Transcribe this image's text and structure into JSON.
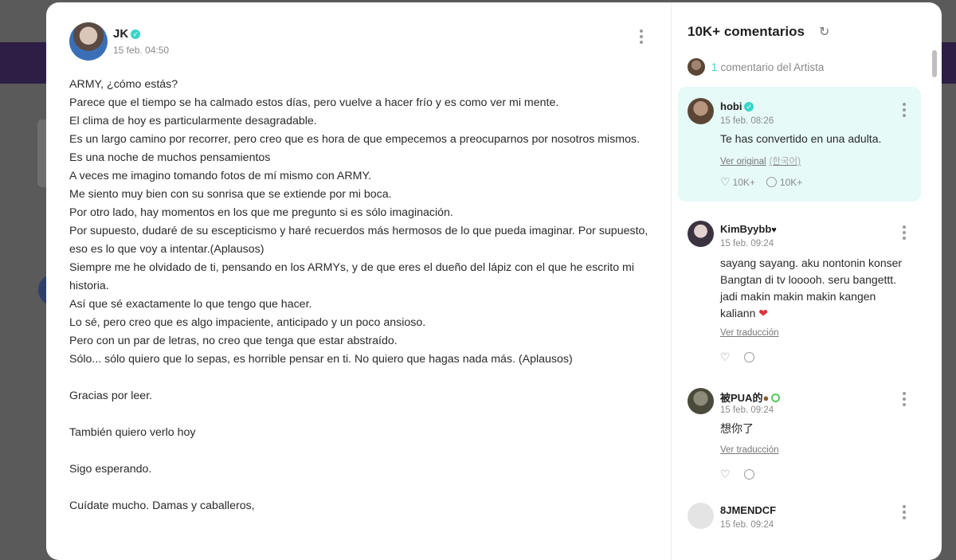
{
  "post": {
    "author": "JK",
    "date": "15 feb. 04:50",
    "paragraphs": [
      "ARMY, ¿cómo estás?",
      "Parece que el tiempo se ha calmado estos días, pero vuelve a hacer frío y es como ver mi mente.",
      "El clima de hoy es particularmente desagradable.",
      "Es un largo camino por recorrer, pero creo que es hora de que empecemos a preocuparnos por nosotros mismos.",
      "Es una noche de muchos pensamientos",
      "A veces me imagino tomando fotos de mí mismo con ARMY.",
      "Me siento muy bien con su sonrisa que se extiende por mi boca.",
      "Por otro lado, hay momentos en los que me pregunto si es sólo imaginación.",
      "Por supuesto, dudaré de su escepticismo y haré recuerdos más hermosos de lo que pueda imaginar. Por supuesto, eso es lo que voy a intentar.(Aplausos)",
      "Siempre me he olvidado de ti, pensando en los ARMYs, y de que eres el dueño del lápiz con el que he escrito mi historia.",
      "Así que sé exactamente lo que tengo que hacer.",
      "Lo sé, pero creo que es algo impaciente, anticipado y un poco ansioso.",
      "Pero con un par de letras, no creo que tenga que estar abstraído.",
      "Sólo... sólo quiero que lo sepas, es horrible pensar en ti. No quiero que hagas nada más. (Aplausos)"
    ],
    "closing": [
      "Gracias por leer.",
      "También quiero verlo hoy",
      "Sigo esperando.",
      "Cuídate mucho. Damas y caballeros,"
    ]
  },
  "comments_panel": {
    "title": "10K+ comentarios",
    "artist_count": "1",
    "artist_label": "comentario del Artista",
    "comments": [
      {
        "name": "hobi",
        "date": "15 feb. 08:26",
        "text": "Te has convertido en una adulta.",
        "link": "Ver original",
        "link_sub": "(한국어)",
        "likes": "10K+",
        "replies": "10K+"
      },
      {
        "name": "KimByybb",
        "date": "15 feb. 09:24",
        "text": "sayang sayang. aku nontonin konser Bangtan di tv looooh. seru bangettt. jadi makin makin makin kangen kaliann",
        "link": "Ver traducción"
      },
      {
        "name": "被PUA的",
        "date": "15 feb. 09:24",
        "text": "想你了",
        "link": "Ver traducción"
      },
      {
        "name": "8JMENDCF",
        "date": "15 feb. 09:24"
      }
    ]
  },
  "colors": {
    "accent": "#3ad5c9",
    "highlight_bg": "#e6faf8",
    "heart": "#e0323c",
    "overlay": "#5a5a5a"
  },
  "icons": [
    "verified-icon",
    "more-options-icon",
    "refresh-icon",
    "like-icon",
    "reply-icon",
    "heart-icon"
  ]
}
